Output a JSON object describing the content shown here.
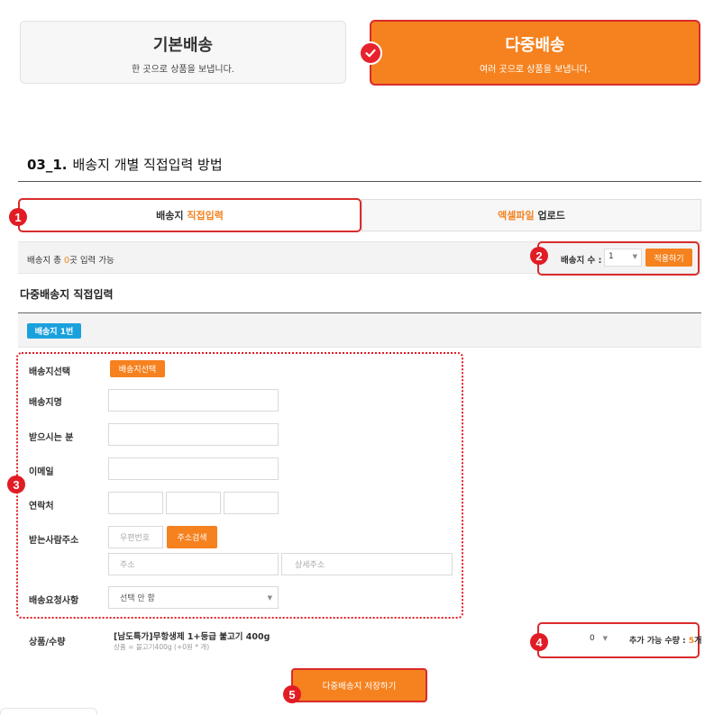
{
  "shipping_methods": {
    "basic": {
      "title": "기본배송",
      "subtitle": "한 곳으로 상품을 보냅니다."
    },
    "multi": {
      "title": "다중배송",
      "subtitle": "여러 곳으로 상품을 보냅니다.",
      "selected": true
    }
  },
  "section": {
    "number": "03_1.",
    "title": "배송지 개별 직접입력 방법"
  },
  "tabs": {
    "direct": {
      "label_a": "배송지",
      "label_b": "직접입력",
      "active": true
    },
    "excel": {
      "label_a": "엑셀파일",
      "label_b": "업로드"
    }
  },
  "count_bar": {
    "text_a": "배송지 총",
    "count": "0",
    "text_b": "곳 입력 가능",
    "dest_count_label": "배송지 수 :",
    "dest_count_value": "1",
    "apply_label": "적용하기"
  },
  "subsection_title": "다중배송지 직접입력",
  "destination_badge": "배송지 1번",
  "form": {
    "select_label": "배송지선택",
    "select_button": "배송지선택",
    "name_label": "배송지명",
    "recipient_label": "받으시는 분",
    "email_label": "이메일",
    "phone_label": "연락처",
    "address_label": "받는사람주소",
    "zip_placeholder": "우편번호",
    "search_button": "주소검색",
    "address_placeholder": "주소",
    "detail_placeholder": "상세주소",
    "request_label": "배송요청사항",
    "request_value": "선택 안 함"
  },
  "product": {
    "label": "상품/수량",
    "name": "[남도특가]무항생제 1+등급 불고기 400g",
    "detail": "상품 = 불고기400g (+0원 * 개)",
    "qty_value": "0",
    "avail_label": "추가 가능 수량 :",
    "avail_count": "5",
    "avail_unit": "개"
  },
  "save_button": "다중배송지 저장하기",
  "markers": [
    "1",
    "2",
    "3",
    "4",
    "5"
  ],
  "colors": {
    "accent": "#f5821f",
    "highlight": "#e11c24",
    "badge": "#1aa1dd"
  }
}
